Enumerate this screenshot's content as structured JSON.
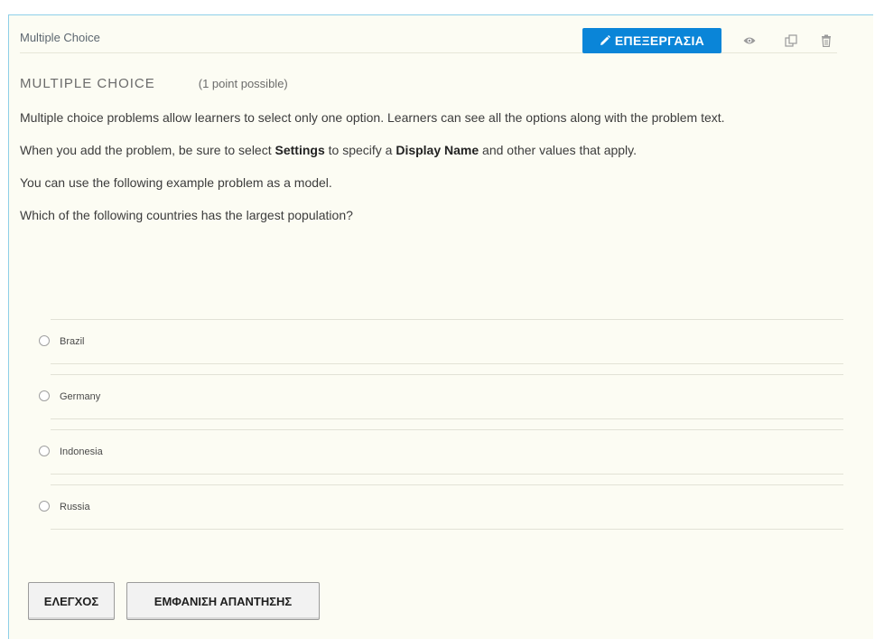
{
  "header": {
    "title": "Multiple Choice",
    "edit_label": "ΕΠΕΞΕΡΓΑΣΙΑ",
    "icons": [
      "pencil-icon",
      "eye-icon",
      "duplicate-icon",
      "trash-icon"
    ],
    "accent_color": "#0a85d8"
  },
  "problem": {
    "title": "MULTIPLE CHOICE",
    "points": "(1 point possible)",
    "intro_1": "Multiple choice problems allow learners to select only one option. Learners can see all the options along with the problem text.",
    "intro_2_pre": "When you add the problem, be sure to select ",
    "intro_2_settings": "Settings",
    "intro_2_mid": " to specify a ",
    "intro_2_display": "Display Name",
    "intro_2_post": " and other values that apply.",
    "intro_3": "You can use the following example problem as a model.",
    "question": "Which of the following countries has the largest population?",
    "choices": [
      "Brazil",
      "Germany",
      "Indonesia",
      "Russia"
    ]
  },
  "actions": {
    "check_label": "ΕΛΕΓΧΟΣ",
    "show_answer_label": "ΕΜΦΑΝΙΣΗ ΑΠΑΝΤΗΣΗΣ"
  }
}
